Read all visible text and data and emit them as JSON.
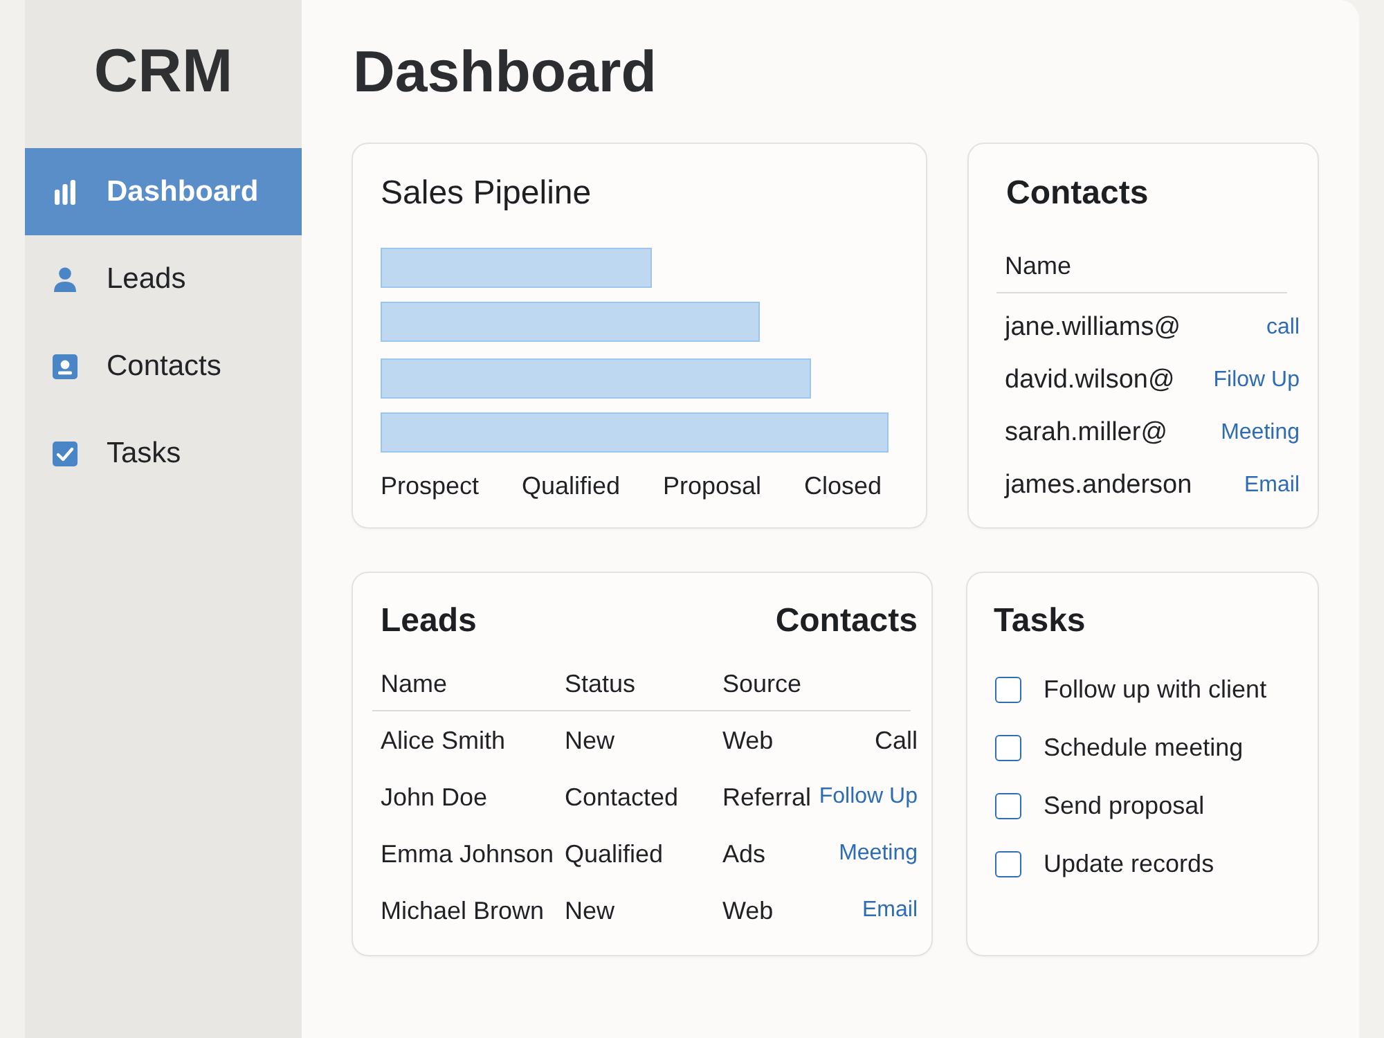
{
  "sidebar": {
    "title": "CRM",
    "items": [
      {
        "label": "Dashboard",
        "selected": true
      },
      {
        "label": "Leads",
        "selected": false
      },
      {
        "label": "Contacts",
        "selected": false
      },
      {
        "label": "Tasks",
        "selected": false
      }
    ]
  },
  "page": {
    "title": "Dashboard"
  },
  "sales_pipeline": {
    "title": "Sales Pipeline",
    "stages": [
      "Prospect",
      "Qualified",
      "Proposal",
      "Closed"
    ]
  },
  "contacts": {
    "title": "Contacts",
    "columns": [
      "Name"
    ],
    "rows": [
      {
        "name": "jane.williams@",
        "action": "call"
      },
      {
        "name": "david.wilson@",
        "action": "Filow Up"
      },
      {
        "name": "sarah.miller@",
        "action": "Meeting"
      },
      {
        "name": "james.anderson",
        "action": "Email"
      }
    ]
  },
  "leads": {
    "title": "Leads",
    "title_right": "Contacts",
    "columns": [
      "Name",
      "Status",
      "Source"
    ],
    "rows": [
      {
        "name": "Alice Smith",
        "status": "New",
        "source": "Web",
        "action": "Call",
        "link": false
      },
      {
        "name": "John Doe",
        "status": "Contacted",
        "source": "Referral",
        "action": "Follow Up",
        "link": true
      },
      {
        "name": "Emma Johnson",
        "status": "Qualified",
        "source": "Ads",
        "action": "Meeting",
        "link": true
      },
      {
        "name": "Michael Brown",
        "status": "New",
        "source": "Web",
        "action": "Email",
        "link": true
      }
    ]
  },
  "tasks": {
    "title": "Tasks",
    "items": [
      {
        "label": "Follow up with client",
        "checked": false
      },
      {
        "label": "Schedule meeting",
        "checked": false
      },
      {
        "label": "Send proposal",
        "checked": false
      },
      {
        "label": "Update records",
        "checked": false
      }
    ]
  }
}
